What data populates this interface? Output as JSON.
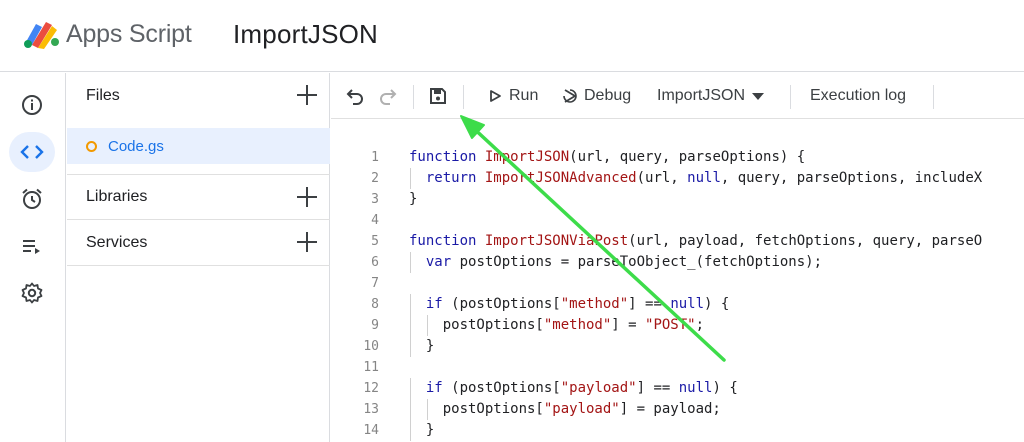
{
  "header": {
    "app_name": "Apps Script",
    "project_name": "ImportJSON"
  },
  "rail": {
    "items": [
      {
        "icon": "info-icon"
      },
      {
        "icon": "code-icon",
        "active": true
      },
      {
        "icon": "alarm-clock-icon"
      },
      {
        "icon": "executions-icon"
      },
      {
        "icon": "gear-icon"
      }
    ]
  },
  "files_panel": {
    "files_label": "Files",
    "file_name": "Code.gs",
    "libraries_label": "Libraries",
    "services_label": "Services"
  },
  "toolbar": {
    "run_label": "Run",
    "debug_label": "Debug",
    "function_select": "ImportJSON",
    "execution_log_label": "Execution log"
  },
  "editor": {
    "lines": [
      {
        "n": "1",
        "html": "<span class=\"kw\">function</span> <span class=\"fn\">ImportJSON</span>(url, query, parseOptions) {"
      },
      {
        "n": "2",
        "html": "  <span class=\"kw\">return</span> <span class=\"fn\">ImportJSONAdvanced</span>(url, <span class=\"kw\">null</span>, query, parseOptions, includeX"
      },
      {
        "n": "3",
        "html": "}"
      },
      {
        "n": "4",
        "html": ""
      },
      {
        "n": "5",
        "html": "<span class=\"kw\">function</span> <span class=\"fn\">ImportJSONViaPost</span>(url, payload, fetchOptions, query, parseO"
      },
      {
        "n": "6",
        "html": "  <span class=\"kw\">var</span> postOptions = parseToObject_(fetchOptions);"
      },
      {
        "n": "7",
        "html": ""
      },
      {
        "n": "8",
        "html": "  <span class=\"kw\">if</span> (postOptions[<span class=\"str\">\"method\"</span>] == <span class=\"kw\">null</span>) {"
      },
      {
        "n": "9",
        "html": "    postOptions[<span class=\"str\">\"method\"</span>] = <span class=\"str\">\"POST\"</span>;"
      },
      {
        "n": "10",
        "html": "  }"
      },
      {
        "n": "11",
        "html": ""
      },
      {
        "n": "12",
        "html": "  <span class=\"kw\">if</span> (postOptions[<span class=\"str\">\"payload\"</span>] == <span class=\"kw\">null</span>) {"
      },
      {
        "n": "13",
        "html": "    postOptions[<span class=\"str\">\"payload\"</span>] = payload;"
      },
      {
        "n": "14",
        "html": "  }"
      }
    ]
  },
  "colors": {
    "accent": "#1a73e8",
    "active_bg": "#e8f0fe",
    "file_dot": "#f29900",
    "annotation_arrow": "#3ddc4a"
  }
}
